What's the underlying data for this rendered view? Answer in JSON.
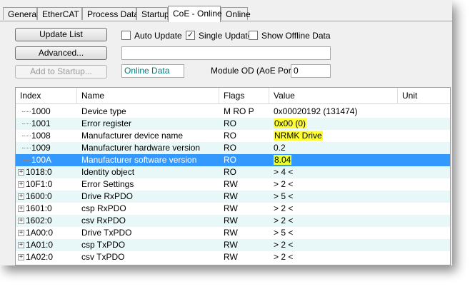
{
  "tabs": [
    "General",
    "EtherCAT",
    "Process Data",
    "Startup",
    "CoE - Online",
    "Online"
  ],
  "active_tab": "CoE - Online",
  "buttons": {
    "update_list": "Update List",
    "advanced": "Advanced...",
    "add_to_startup": "Add to Startup..."
  },
  "checkboxes": {
    "auto_update": {
      "label": "Auto Update",
      "checked": false
    },
    "single_update": {
      "label": "Single Update",
      "checked": true
    },
    "show_offline": {
      "label": "Show Offline Data",
      "checked": false
    }
  },
  "online_data": "Online Data",
  "module_od": {
    "label": "Module OD (AoE Port):",
    "value": "0"
  },
  "table": {
    "columns": [
      "Index",
      "Name",
      "Flags",
      "Value",
      "Unit"
    ],
    "rows": [
      {
        "index": "1000",
        "name": "Device type",
        "flags": "M RO P",
        "value": "0x00020192 (131474)",
        "expandable": false,
        "highlight": false,
        "selected": false
      },
      {
        "index": "1001",
        "name": "Error register",
        "flags": "RO",
        "value": "0x00 (0)",
        "expandable": false,
        "highlight": true,
        "selected": false
      },
      {
        "index": "1008",
        "name": "Manufacturer device name",
        "flags": "RO",
        "value": "NRMK Drive",
        "expandable": false,
        "highlight": true,
        "selected": false
      },
      {
        "index": "1009",
        "name": "Manufacturer hardware version",
        "flags": "RO",
        "value": "0.2",
        "expandable": false,
        "highlight": false,
        "selected": false
      },
      {
        "index": "100A",
        "name": "Manufacturer software version",
        "flags": "RO",
        "value": "8.04",
        "expandable": false,
        "highlight": true,
        "selected": true
      },
      {
        "index": "1018:0",
        "name": "Identity object",
        "flags": "RO",
        "value": "> 4 <",
        "expandable": true,
        "highlight": false,
        "selected": false
      },
      {
        "index": "10F1:0",
        "name": "Error Settings",
        "flags": "RW",
        "value": "> 2 <",
        "expandable": true,
        "highlight": false,
        "selected": false
      },
      {
        "index": "1600:0",
        "name": "Drive RxPDO",
        "flags": "RW",
        "value": "> 5 <",
        "expandable": true,
        "highlight": false,
        "selected": false
      },
      {
        "index": "1601:0",
        "name": "csp RxPDO",
        "flags": "RW",
        "value": "> 2 <",
        "expandable": true,
        "highlight": false,
        "selected": false
      },
      {
        "index": "1602:0",
        "name": "csv RxPDO",
        "flags": "RW",
        "value": "> 2 <",
        "expandable": true,
        "highlight": false,
        "selected": false
      },
      {
        "index": "1A00:0",
        "name": "Drive TxPDO",
        "flags": "RW",
        "value": "> 5 <",
        "expandable": true,
        "highlight": false,
        "selected": false
      },
      {
        "index": "1A01:0",
        "name": "csp TxPDO",
        "flags": "RW",
        "value": "> 2 <",
        "expandable": true,
        "highlight": false,
        "selected": false
      },
      {
        "index": "1A02:0",
        "name": "csv TxPDO",
        "flags": "RW",
        "value": "> 2 <",
        "expandable": true,
        "highlight": false,
        "selected": false
      }
    ]
  },
  "colors": {
    "selection": "#3399ff",
    "highlight": "#ffff33",
    "alt_row": "#e8f7f7"
  }
}
